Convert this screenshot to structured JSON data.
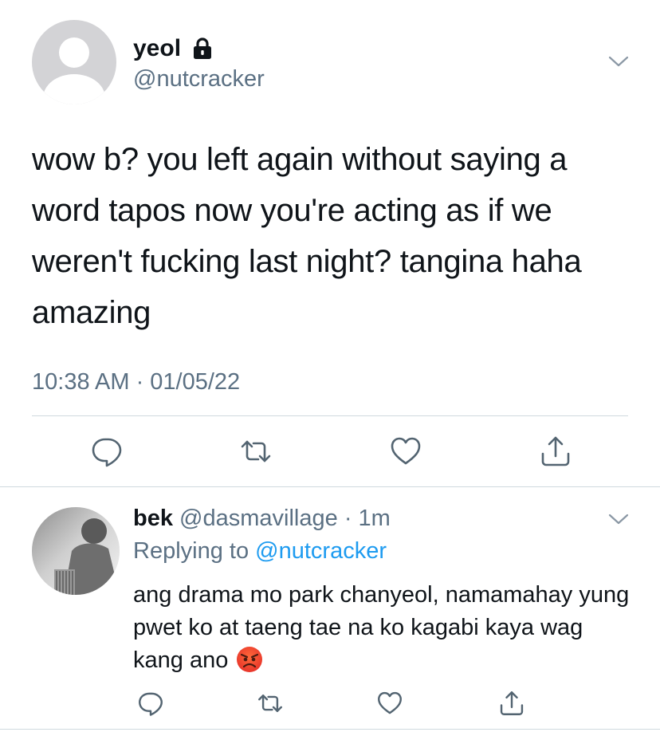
{
  "main_tweet": {
    "display_name": "yeol",
    "handle": "@nutcracker",
    "text": "wow b? you left again without saying a word tapos now you're acting as if we weren't fucking last night? tangina haha amazing",
    "timestamp": "10:38 AM · 01/05/22",
    "icons": {
      "lock": "lock-icon",
      "more": "chevron-down-icon",
      "reply": "reply-icon",
      "retweet": "retweet-icon",
      "like": "heart-icon",
      "share": "share-icon"
    }
  },
  "reply_tweet": {
    "display_name": "bek",
    "handle": "@dasmavillage",
    "separator": "·",
    "time": "1m",
    "replying_label": "Replying to",
    "replying_handle": "@nutcracker",
    "text": "ang drama mo park chanyeol, namamahay yung pwet ko at taeng tae na ko kagabi kaya wag kang ano",
    "emoji": "angry-face-emoji"
  },
  "colors": {
    "text_primary": "#0f1419",
    "text_secondary": "#5b7083",
    "link": "#1d9bf0",
    "divider": "#cfd9de"
  }
}
